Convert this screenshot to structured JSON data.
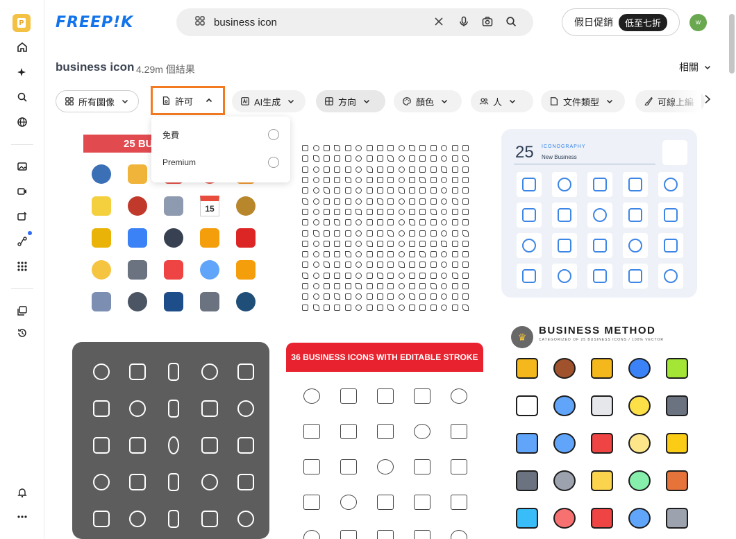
{
  "brand": {
    "logo": "FREEP!K",
    "badge": "P"
  },
  "search": {
    "value": "business icon",
    "placeholder": ""
  },
  "header": {
    "promo_label": "假日促銷",
    "promo_pill": "低至七折",
    "avatar_initial": "w"
  },
  "results": {
    "title": "business icon",
    "count": "4.29m 個結果",
    "sort_label": "相關"
  },
  "filters": {
    "all_images": "所有圖像",
    "license": "許可",
    "ai": "AI生成",
    "orientation": "方向",
    "color": "顏色",
    "people": "人",
    "file_type": "文件類型",
    "editable_stroke": "可線上編"
  },
  "license_menu": {
    "options": [
      {
        "label": "免費"
      },
      {
        "label": "Premium"
      }
    ]
  },
  "cards": [
    {
      "banner": "25 BU"
    },
    {},
    {
      "number": "25",
      "tag": "ICONOGRAPHY",
      "subtitle": "New Business"
    },
    {},
    {
      "banner": "36 BUSINESS ICONS WITH EDITABLE STROKE"
    },
    {
      "title": "BUSINESS METHOD",
      "subtitle": "CATEGORIZED OF 25 BUSINESS ICONS / 100% VECTOR"
    }
  ],
  "card1_date": "15",
  "colors": {
    "accent": "#1273eb",
    "highlight": "#f47a21",
    "banner_red": "#e8222e"
  }
}
